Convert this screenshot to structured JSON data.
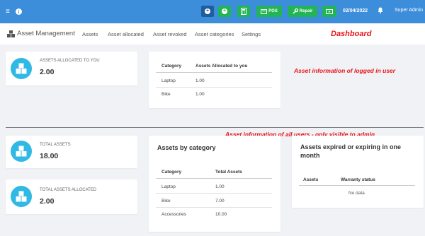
{
  "topbar": {
    "date": "02/04/2022",
    "user": "Super Admin",
    "pos_label": "POS",
    "repair_label": "Repair"
  },
  "nav": {
    "brand": "Asset Management",
    "items": [
      "Assets",
      "Asset allocated",
      "Asset revoked",
      "Asset categories",
      "Settings"
    ],
    "dashboard_label": "Dashboard"
  },
  "user_section": {
    "allocated_label": "ASSETS ALLOCATED TO YOU",
    "allocated_value": "2.00",
    "table": {
      "headers": [
        "Category",
        "Assets Allocated to you"
      ],
      "rows": [
        [
          "Laptop",
          "1.00"
        ],
        [
          "Bike",
          "1.00"
        ]
      ]
    },
    "annotation": "Asset information of logged in user"
  },
  "admin_section": {
    "annotation": "Asset information of all users - only visible to admin",
    "total_label": "TOTAL ASSETS",
    "total_value": "18.00",
    "total_allocated_label": "TOTAL ASSETS ALLOCATED",
    "total_allocated_value": "2.00",
    "by_category": {
      "title": "Assets by category",
      "headers": [
        "Category",
        "Total Assets"
      ],
      "rows": [
        [
          "Laptop",
          "1.00"
        ],
        [
          "Bike",
          "7.00"
        ],
        [
          "Accessories",
          "10.00"
        ]
      ]
    },
    "expiring": {
      "title": "Assets expired or expiring in one month",
      "headers": [
        "Assets",
        "Warranty status"
      ],
      "empty_text": "No data"
    }
  },
  "colors": {
    "topbar": "#3c8dda",
    "button_dark": "#1f5d9c",
    "button_green": "#22b456",
    "avatar": "#2fb9e4",
    "annotation": "#e8141a"
  }
}
